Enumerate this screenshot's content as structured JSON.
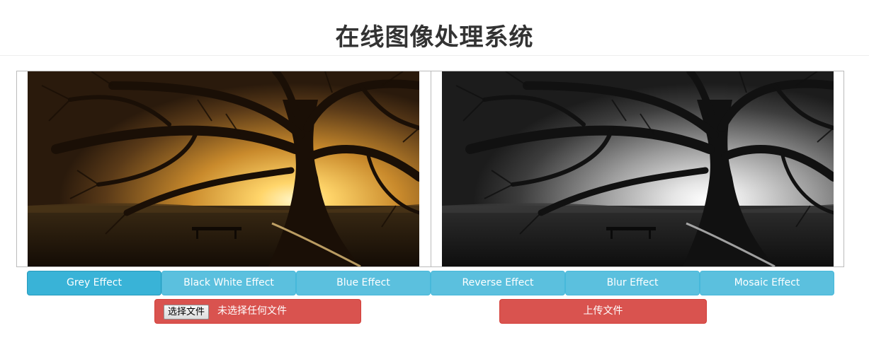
{
  "header": {
    "title": "在线图像处理系统"
  },
  "images": {
    "original_icon": "tree-sunset-photo",
    "processed_icon": "tree-greyscale-photo"
  },
  "effects": {
    "grey": "Grey Effect",
    "black_white": "Black White Effect",
    "blue": "Blue Effect",
    "reverse": "Reverse Effect",
    "blur": "Blur Effect",
    "mosaic": "Mosaic Effect",
    "active": "Grey Effect"
  },
  "file_input": {
    "choose_label": "选择文件",
    "no_file_text": "未选择任何文件"
  },
  "upload": {
    "label": "上传文件"
  },
  "colors": {
    "info_button": "#5bc0de",
    "danger_button": "#d9534f",
    "title_text": "#333333"
  }
}
